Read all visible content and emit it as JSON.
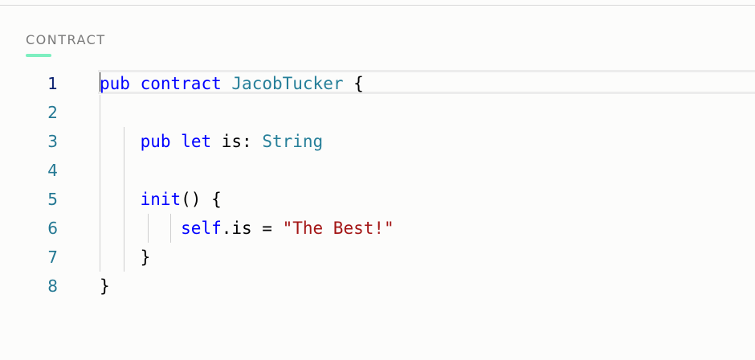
{
  "tab": {
    "label": "CONTRACT",
    "accent_color": "#7defc0"
  },
  "editor": {
    "lines": [
      {
        "number": "1",
        "tokens": [
          {
            "t": "pub",
            "k": "kw"
          },
          {
            "t": " ",
            "k": "id"
          },
          {
            "t": "contract",
            "k": "kw"
          },
          {
            "t": " ",
            "k": "id"
          },
          {
            "t": "JacobTucker",
            "k": "ty"
          },
          {
            "t": " {",
            "k": "id"
          }
        ]
      },
      {
        "number": "2",
        "tokens": []
      },
      {
        "number": "3",
        "tokens": [
          {
            "t": "    ",
            "k": "id"
          },
          {
            "t": "pub",
            "k": "kw"
          },
          {
            "t": " ",
            "k": "id"
          },
          {
            "t": "let",
            "k": "kw"
          },
          {
            "t": " is: ",
            "k": "id"
          },
          {
            "t": "String",
            "k": "ty"
          }
        ]
      },
      {
        "number": "4",
        "tokens": []
      },
      {
        "number": "5",
        "tokens": [
          {
            "t": "    ",
            "k": "id"
          },
          {
            "t": "init",
            "k": "kw"
          },
          {
            "t": "() {",
            "k": "id"
          }
        ]
      },
      {
        "number": "6",
        "tokens": [
          {
            "t": "        ",
            "k": "id"
          },
          {
            "t": "self",
            "k": "kw"
          },
          {
            "t": ".is = ",
            "k": "id"
          },
          {
            "t": "\"The Best!\"",
            "k": "str"
          }
        ]
      },
      {
        "number": "7",
        "tokens": [
          {
            "t": "    }",
            "k": "id"
          }
        ]
      },
      {
        "number": "8",
        "tokens": [
          {
            "t": "}",
            "k": "id"
          }
        ]
      }
    ],
    "active_line": "1"
  }
}
